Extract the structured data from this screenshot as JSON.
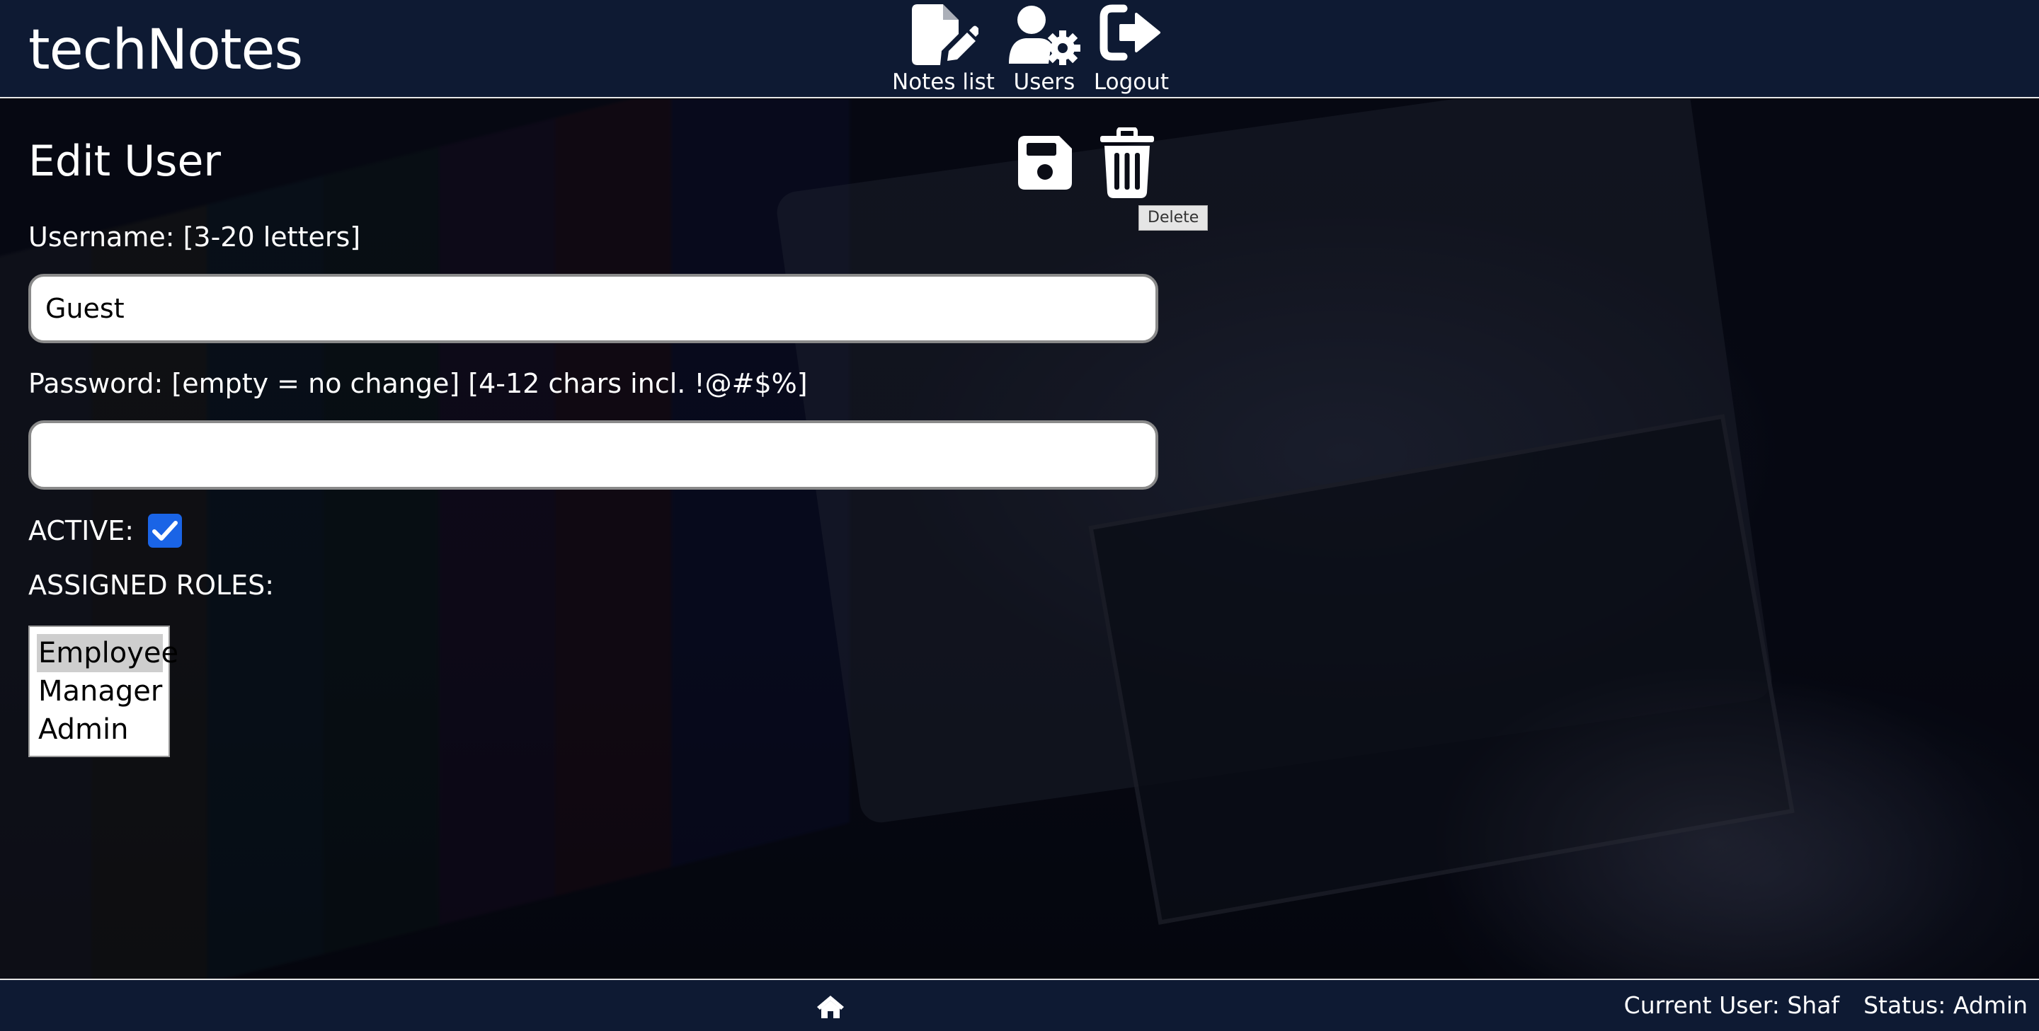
{
  "app": {
    "title": "techNotes"
  },
  "nav": {
    "notes_label": "Notes list",
    "users_label": "Users",
    "logout_label": "Logout"
  },
  "page": {
    "title": "Edit User",
    "save_icon": "floppy-disk-icon",
    "delete_icon": "trash-can-icon",
    "delete_tooltip": "Delete"
  },
  "form": {
    "username_label": "Username: [3-20 letters]",
    "username_value": "Guest",
    "password_label": "Password: [empty = no change] [4-12 chars incl. !@#$%]",
    "password_value": "",
    "active_label": "ACTIVE:",
    "active_checked": true,
    "roles_label": "ASSIGNED ROLES:",
    "roles": [
      {
        "label": "Employee",
        "selected": true
      },
      {
        "label": "Manager",
        "selected": false
      },
      {
        "label": "Admin",
        "selected": false
      }
    ]
  },
  "footer": {
    "home_icon": "house-icon",
    "current_user": "Current User: Shaf",
    "status": "Status: Admin"
  },
  "colors": {
    "header_bg": "#0e1a33",
    "checkbox_accent": "#1a64e6",
    "selected_option_bg": "#cecece"
  }
}
